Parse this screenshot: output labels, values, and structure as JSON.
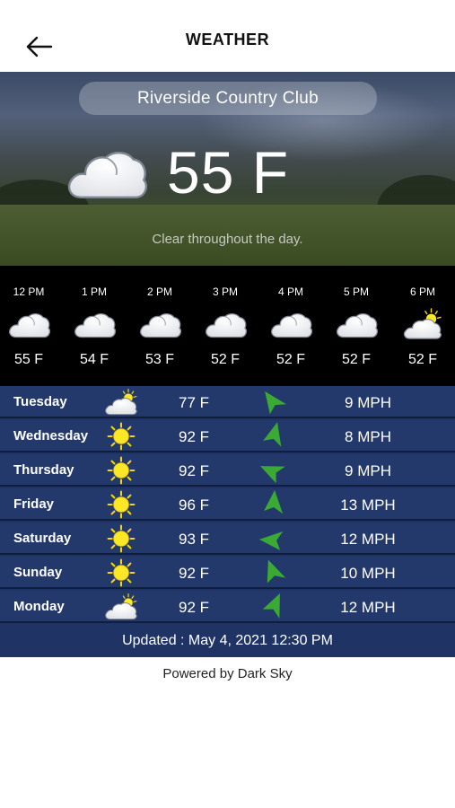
{
  "header": {
    "title": "WEATHER"
  },
  "current": {
    "location": "Riverside Country Club",
    "temperature": "55 F",
    "summary": "Clear throughout the day.",
    "icon": "cloud-icon"
  },
  "hourly": [
    {
      "time": "12 PM",
      "temp": "55 F",
      "icon": "cloud-icon"
    },
    {
      "time": "1 PM",
      "temp": "54 F",
      "icon": "cloud-icon"
    },
    {
      "time": "2 PM",
      "temp": "53 F",
      "icon": "cloud-icon"
    },
    {
      "time": "3 PM",
      "temp": "52 F",
      "icon": "cloud-icon"
    },
    {
      "time": "4 PM",
      "temp": "52 F",
      "icon": "cloud-icon"
    },
    {
      "time": "5 PM",
      "temp": "52 F",
      "icon": "cloud-icon"
    },
    {
      "time": "6 PM",
      "temp": "52 F",
      "icon": "partly-sunny-icon"
    }
  ],
  "daily": [
    {
      "day": "Tuesday",
      "icon": "partly-sunny-icon",
      "temp": "77 F",
      "wind_icon": "wind-direction-icon",
      "wind_speed": "9 MPH"
    },
    {
      "day": "Wednesday",
      "icon": "sun-icon",
      "temp": "92 F",
      "wind_icon": "wind-direction-icon",
      "wind_speed": "8 MPH"
    },
    {
      "day": "Thursday",
      "icon": "sun-icon",
      "temp": "92 F",
      "wind_icon": "wind-direction-icon",
      "wind_speed": "9 MPH"
    },
    {
      "day": "Friday",
      "icon": "sun-icon",
      "temp": "96 F",
      "wind_icon": "wind-direction-icon",
      "wind_speed": "13 MPH"
    },
    {
      "day": "Saturday",
      "icon": "sun-icon",
      "temp": "93 F",
      "wind_icon": "wind-direction-icon",
      "wind_speed": "12 MPH"
    },
    {
      "day": "Sunday",
      "icon": "sun-icon",
      "temp": "92 F",
      "wind_icon": "wind-direction-icon",
      "wind_speed": "10 MPH"
    },
    {
      "day": "Monday",
      "icon": "partly-sunny-icon",
      "temp": "92 F",
      "wind_icon": "wind-direction-icon",
      "wind_speed": "12 MPH"
    }
  ],
  "updated": "Updated : May 4, 2021 12:30 PM",
  "footer": {
    "powered_by": "Powered by Dark Sky"
  },
  "colors": {
    "daily_background": "#23396c",
    "wind_arrow": "#3aaa35",
    "sun": "#f5e01a"
  }
}
